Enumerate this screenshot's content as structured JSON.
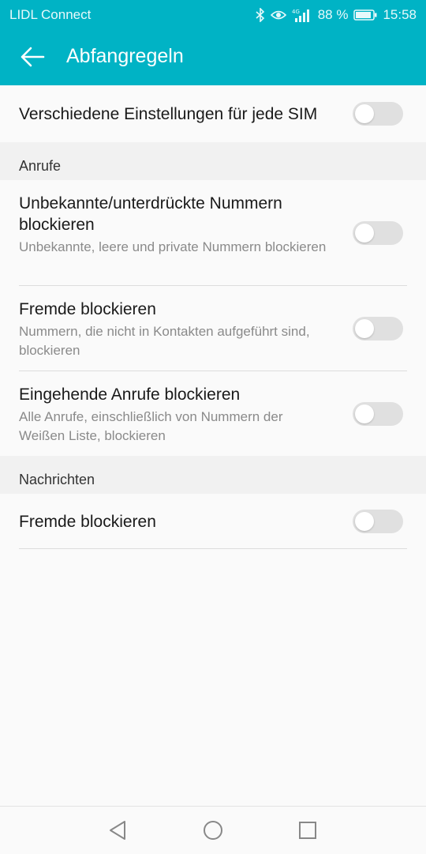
{
  "status_bar": {
    "carrier": "LIDL Connect",
    "battery": "88 %",
    "time": "15:58",
    "icons": [
      "bluetooth-icon",
      "eye-icon",
      "signal-icon",
      "battery-icon"
    ]
  },
  "app_bar": {
    "title": "Abfangregeln",
    "back_icon": "arrow-left-icon"
  },
  "top_setting": {
    "label": "Verschiedene Einstellungen für jede SIM",
    "enabled": false
  },
  "sections": [
    {
      "title": "Anrufe",
      "items": [
        {
          "label": "Unbekannte/unterdrückte Nummern blockieren",
          "description": "Unbekannte, leere und private Nummern blockieren",
          "enabled": false
        },
        {
          "label": "Fremde blockieren",
          "description": "Nummern, die nicht in Kontakten aufgeführt sind, blockieren",
          "enabled": false
        },
        {
          "label": "Eingehende Anrufe blockieren",
          "description": "Alle Anrufe, einschließlich von Nummern der Weißen Liste, blockieren",
          "enabled": false
        }
      ]
    },
    {
      "title": "Nachrichten",
      "items": [
        {
          "label": "Fremde blockieren",
          "enabled": false
        }
      ]
    }
  ],
  "nav_bar": {
    "icons": [
      "back-triangle-icon",
      "home-circle-icon",
      "recents-square-icon"
    ]
  },
  "colors": {
    "accent": "#00b3c5",
    "toggle_off": "#e0e0e0",
    "section_bg": "#f1f1f1"
  }
}
